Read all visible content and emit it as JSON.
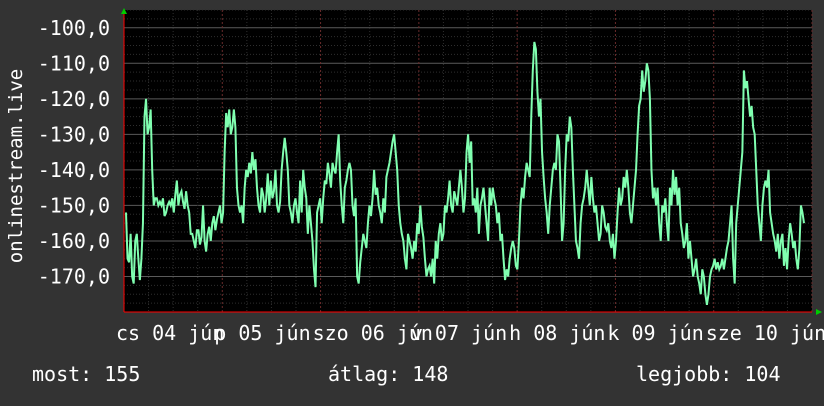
{
  "chart_data": {
    "type": "line",
    "ylabel": "onlinestream.live",
    "ylim": [
      -180,
      -95
    ],
    "y_ticks": [
      "-100,0",
      "-110,0",
      "-120,0",
      "-130,0",
      "-140,0",
      "-150,0",
      "-160,0",
      "-170,0"
    ],
    "x_ticks": [
      "cs 04 jún",
      "p 05 jún",
      "szo 06 jún",
      "v 07 jún",
      "h 08 jún",
      "k 09 jún",
      "sze 10 jún"
    ],
    "grid": true,
    "colors": {
      "line": "#80ffb0",
      "plot_bg": "#000000",
      "page_bg": "#333333",
      "grid": "#555555",
      "axis": "#ff0000",
      "arrow": "#00cc00"
    },
    "series": [
      {
        "values": [
          -152,
          -165,
          -166,
          -158,
          -170,
          -172,
          -160,
          -158,
          -165,
          -171,
          -165,
          -155,
          -125,
          -120,
          -130,
          -128,
          -123,
          -140,
          -150,
          -148,
          -148,
          -150,
          -149,
          -150,
          -148,
          -153,
          -152,
          -150,
          -149,
          -150,
          -148,
          -152,
          -147,
          -143,
          -150,
          -147,
          -146,
          -149,
          -151,
          -146,
          -150,
          -152,
          -158,
          -158,
          -160,
          -162,
          -157,
          -157,
          -161,
          -159,
          -150,
          -160,
          -163,
          -158,
          -156,
          -160,
          -155,
          -153,
          -157,
          -154,
          -152,
          -150,
          -155,
          -152,
          -135,
          -124,
          -128,
          -123,
          -130,
          -128,
          -123,
          -128,
          -145,
          -150,
          -152,
          -150,
          -155,
          -145,
          -140,
          -142,
          -138,
          -141,
          -135,
          -140,
          -137,
          -145,
          -150,
          -152,
          -145,
          -147,
          -152,
          -148,
          -141,
          -150,
          -143,
          -148,
          -146,
          -140,
          -150,
          -152,
          -149,
          -140,
          -135,
          -131,
          -135,
          -140,
          -150,
          -152,
          -155,
          -150,
          -148,
          -152,
          -155,
          -143,
          -152,
          -140,
          -145,
          -148,
          -158,
          -150,
          -155,
          -160,
          -168,
          -173,
          -152,
          -150,
          -148,
          -155,
          -148,
          -143,
          -144,
          -138,
          -141,
          -145,
          -138,
          -140,
          -141,
          -135,
          -130,
          -143,
          -150,
          -155,
          -145,
          -143,
          -140,
          -138,
          -140,
          -150,
          -153,
          -148,
          -170,
          -172,
          -166,
          -162,
          -158,
          -160,
          -162,
          -155,
          -150,
          -153,
          -148,
          -140,
          -147,
          -145,
          -150,
          -152,
          -155,
          -148,
          -152,
          -142,
          -140,
          -138,
          -135,
          -132,
          -130,
          -135,
          -140,
          -150,
          -155,
          -158,
          -160,
          -165,
          -168,
          -158,
          -160,
          -162,
          -165,
          -160,
          -163,
          -155,
          -158,
          -150,
          -156,
          -159,
          -165,
          -170,
          -168,
          -167,
          -170,
          -165,
          -172,
          -160,
          -165,
          -158,
          -155,
          -160,
          -158,
          -150,
          -152,
          -148,
          -143,
          -150,
          -152,
          -146,
          -148,
          -150,
          -145,
          -140,
          -145,
          -152,
          -148,
          -135,
          -130,
          -138,
          -132,
          -150,
          -148,
          -152,
          -145,
          -158,
          -150,
          -148,
          -145,
          -150,
          -155,
          -160,
          -145,
          -150,
          -145,
          -148,
          -150,
          -155,
          -152,
          -160,
          -158,
          -165,
          -171,
          -168,
          -170,
          -165,
          -162,
          -160,
          -162,
          -167,
          -168,
          -160,
          -150,
          -145,
          -148,
          -142,
          -138,
          -140,
          -142,
          -125,
          -112,
          -104,
          -106,
          -118,
          -125,
          -120,
          -135,
          -142,
          -148,
          -152,
          -158,
          -150,
          -145,
          -140,
          -138,
          -140,
          -130,
          -132,
          -145,
          -160,
          -155,
          -140,
          -130,
          -132,
          -125,
          -128,
          -140,
          -150,
          -160,
          -162,
          -165,
          -155,
          -150,
          -148,
          -145,
          -140,
          -145,
          -150,
          -142,
          -148,
          -152,
          -150,
          -155,
          -160,
          -158,
          -150,
          -152,
          -156,
          -157,
          -155,
          -160,
          -162,
          -158,
          -165,
          -160,
          -152,
          -145,
          -150,
          -148,
          -142,
          -145,
          -140,
          -145,
          -152,
          -155,
          -150,
          -145,
          -140,
          -130,
          -122,
          -120,
          -112,
          -118,
          -115,
          -110,
          -112,
          -120,
          -140,
          -148,
          -145,
          -150,
          -145,
          -155,
          -160,
          -150,
          -152,
          -148,
          -155,
          -160,
          -145,
          -150,
          -140,
          -147,
          -142,
          -150,
          -145,
          -155,
          -158,
          -162,
          -160,
          -155,
          -165,
          -160,
          -165,
          -170,
          -168,
          -165,
          -170,
          -172,
          -175,
          -168,
          -170,
          -175,
          -178,
          -175,
          -170,
          -168,
          -167,
          -165,
          -168,
          -166,
          -168,
          -167,
          -165,
          -168,
          -165,
          -162,
          -160,
          -155,
          -150,
          -165,
          -172,
          -155,
          -150,
          -145,
          -140,
          -135,
          -112,
          -117,
          -115,
          -120,
          -125,
          -122,
          -128,
          -130,
          -140,
          -150,
          -155,
          -160,
          -150,
          -145,
          -143,
          -145,
          -140,
          -152,
          -155,
          -158,
          -160,
          -163,
          -158,
          -165,
          -160,
          -158,
          -167,
          -162,
          -168,
          -160,
          -155,
          -158,
          -162,
          -160,
          -165,
          -168,
          -162,
          -150,
          -152,
          -155
        ]
      }
    ]
  },
  "stats": {
    "current": "most: 155",
    "average": "átlag: 148",
    "best": "legjobb: 104"
  }
}
